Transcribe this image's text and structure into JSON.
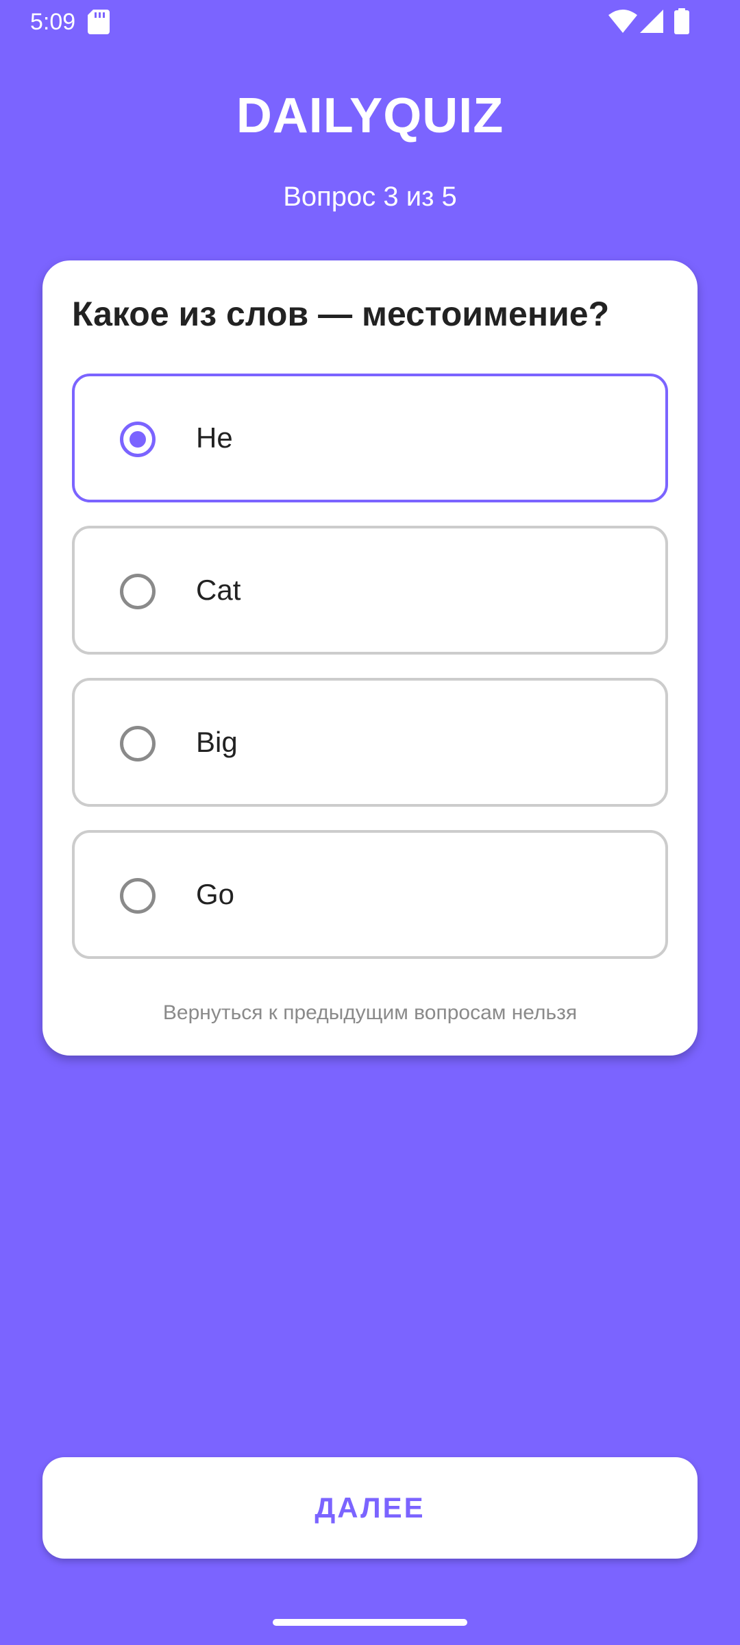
{
  "status_bar": {
    "time": "5:09",
    "icons": [
      "sd-card-icon",
      "wifi-icon",
      "signal-icon",
      "battery-icon"
    ]
  },
  "header": {
    "app_title": "DAILYQUIZ",
    "progress": "Вопрос 3 из 5"
  },
  "quiz": {
    "question": "Какое из слов — местоимение?",
    "options": [
      {
        "label": "He",
        "selected": true
      },
      {
        "label": "Cat",
        "selected": false
      },
      {
        "label": "Big",
        "selected": false
      },
      {
        "label": "Go",
        "selected": false
      }
    ],
    "footnote": "Вернуться к предыдущим вопросам нельзя"
  },
  "actions": {
    "next_label": "ДАЛЕЕ"
  },
  "colors": {
    "background": "#7B64FF",
    "accent": "#7B64FF",
    "card": "#FFFFFF",
    "unselected_border": "#CCCCCC",
    "muted_text": "#8A8A8A"
  }
}
